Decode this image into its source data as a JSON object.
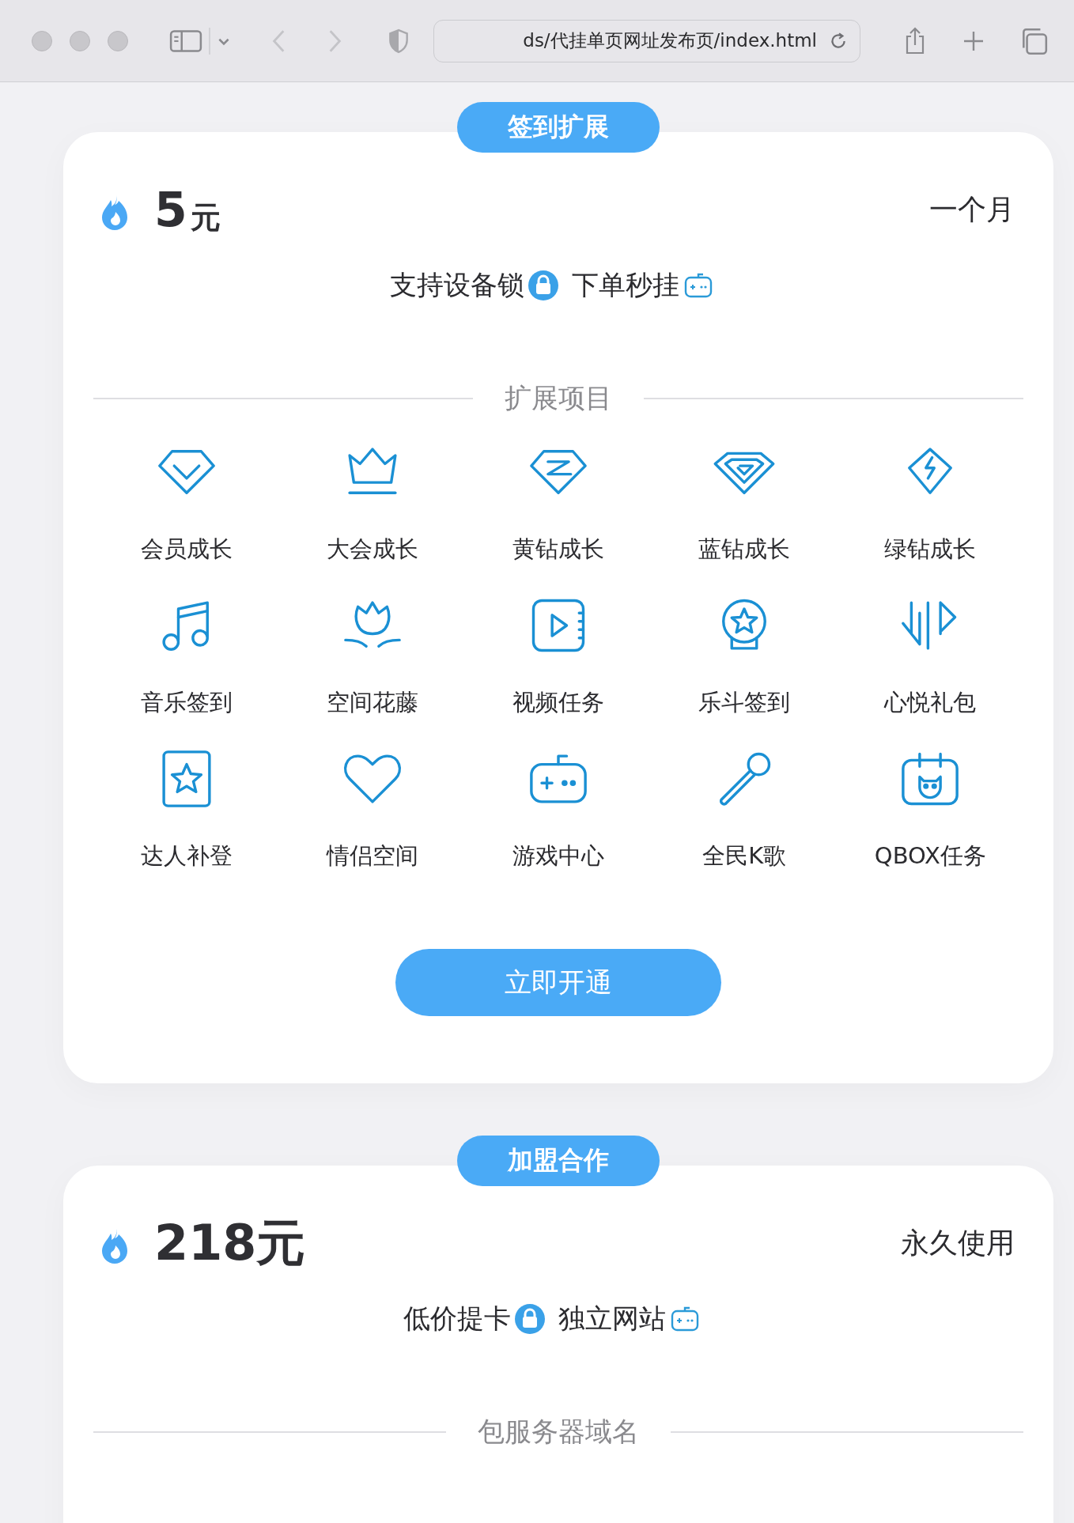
{
  "browser": {
    "url": "ds/代挂单页网址发布页/index.html"
  },
  "plans": [
    {
      "badge": "签到扩展",
      "price": "5",
      "unit": "元",
      "period": "一个月",
      "features": [
        {
          "text": "支持设备锁",
          "kind": "lock"
        },
        {
          "text": "下单秒挂",
          "kind": "gamepad"
        }
      ],
      "section_title": "扩展项目",
      "items": [
        {
          "label": "会员成长",
          "kind": "diamond-check"
        },
        {
          "label": "大会成长",
          "kind": "crown"
        },
        {
          "label": "黄钻成长",
          "kind": "diamond-z"
        },
        {
          "label": "蓝钻成长",
          "kind": "diamond-g"
        },
        {
          "label": "绿钻成长",
          "kind": "diamond-bolt"
        },
        {
          "label": "音乐签到",
          "kind": "music"
        },
        {
          "label": "空间花藤",
          "kind": "flower"
        },
        {
          "label": "视频任务",
          "kind": "video"
        },
        {
          "label": "乐斗签到",
          "kind": "crystal-star"
        },
        {
          "label": "心悦礼包",
          "kind": "arrows"
        },
        {
          "label": "达人补登",
          "kind": "card-star"
        },
        {
          "label": "情侣空间",
          "kind": "heart"
        },
        {
          "label": "游戏中心",
          "kind": "gamepad"
        },
        {
          "label": "全民K歌",
          "kind": "microphone"
        },
        {
          "label": "QBOX任务",
          "kind": "calendar-cat"
        }
      ],
      "button": "立即开通"
    },
    {
      "badge": "加盟合作",
      "price": "218元",
      "period": "永久使用",
      "features": [
        {
          "text": "低价提卡",
          "kind": "lock"
        },
        {
          "text": "独立网站",
          "kind": "gamepad"
        }
      ],
      "section_title": "包服务器域名"
    }
  ]
}
